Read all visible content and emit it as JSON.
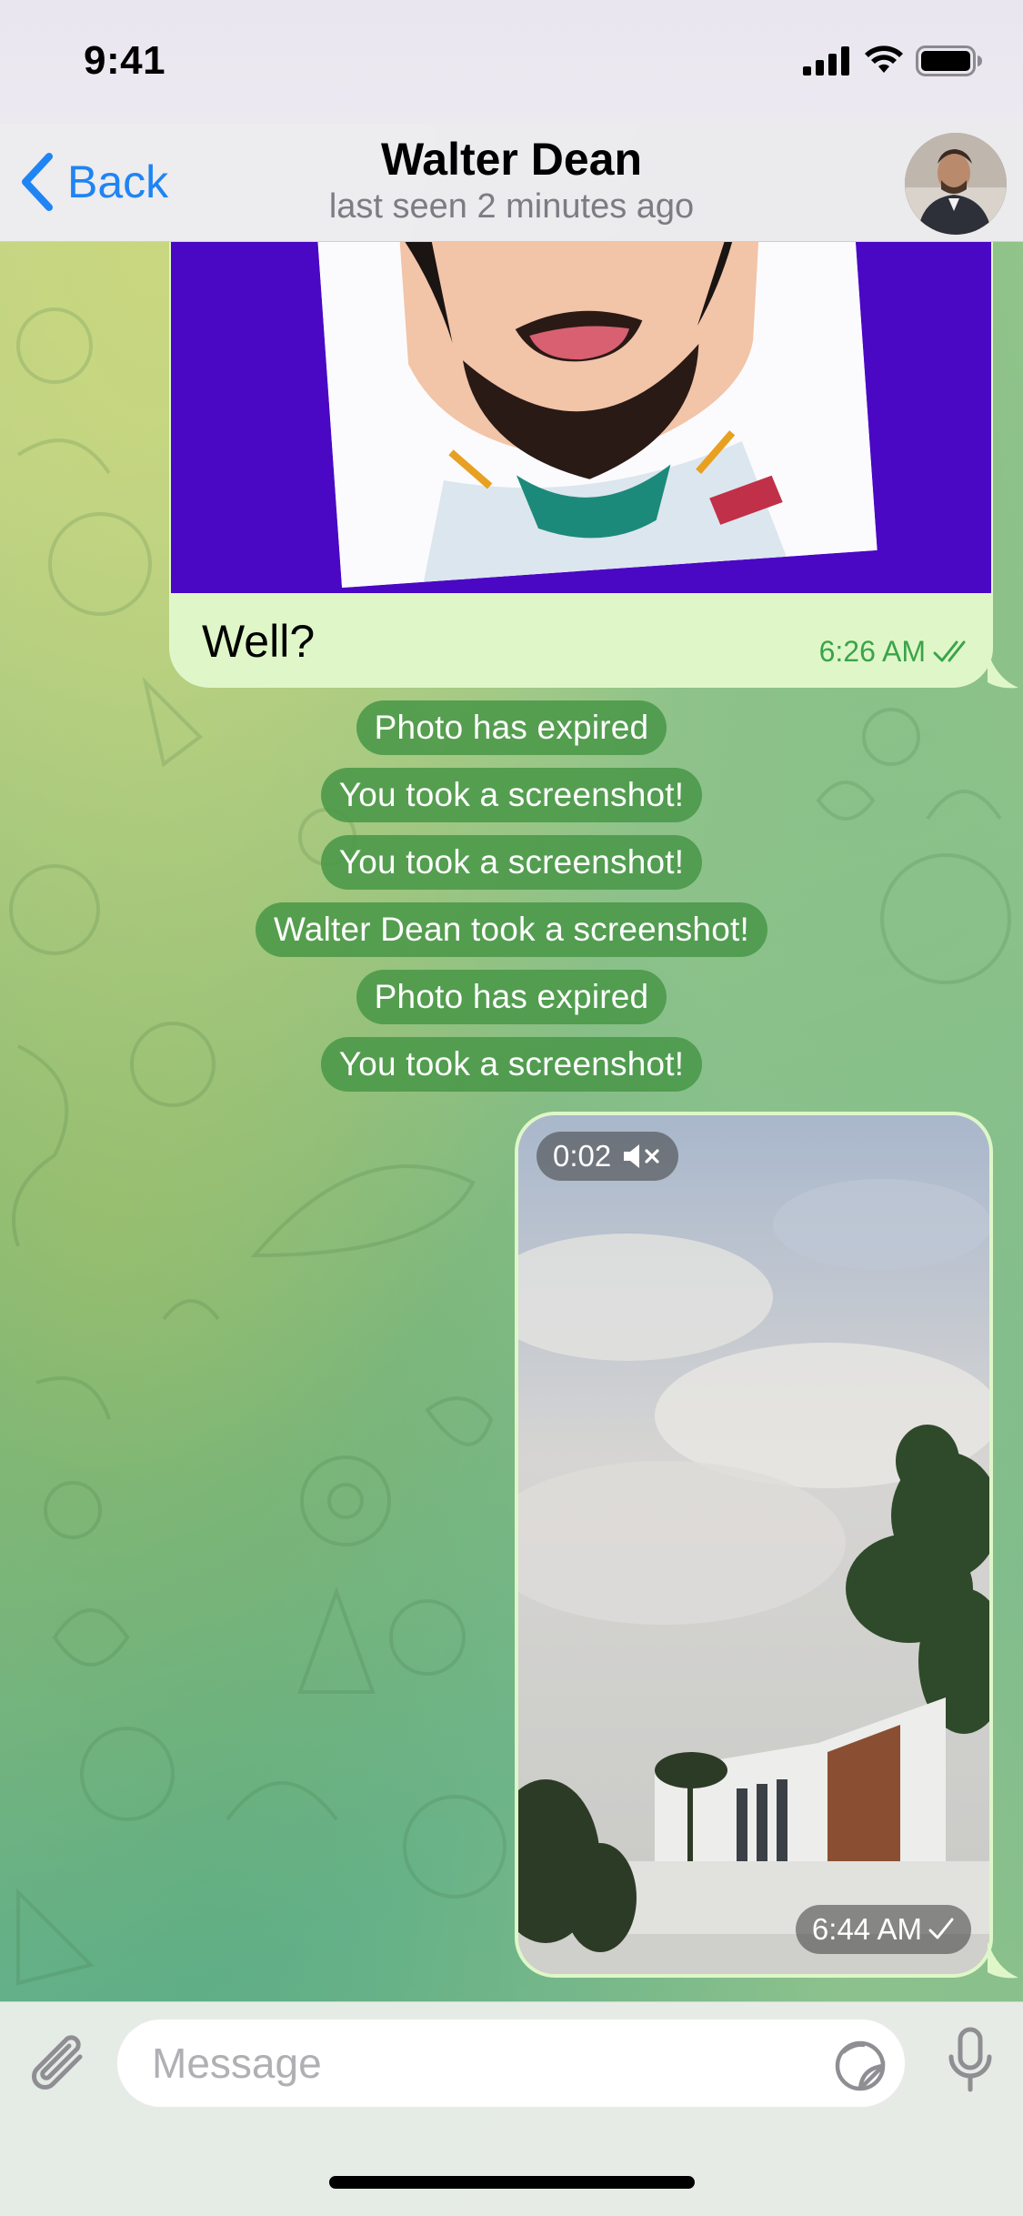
{
  "status_bar": {
    "time": "9:41"
  },
  "nav": {
    "back_label": "Back",
    "title": "Walter Dean",
    "subtitle": "last seen 2 minutes ago"
  },
  "messages": {
    "photo_message": {
      "caption": "Well?",
      "time": "6:26 AM"
    },
    "service": [
      "Photo has expired",
      "You took a screenshot!",
      "You took a screenshot!",
      "Walter Dean took a screenshot!",
      "Photo has expired",
      "You took a screenshot!"
    ],
    "video_message": {
      "duration": "0:02",
      "time": "6:44 AM"
    }
  },
  "input": {
    "placeholder": "Message"
  },
  "colors": {
    "accent": "#1f84f4",
    "outgoing_bubble": "#dff7c8",
    "outgoing_meta": "#3aa44a",
    "service_bg": "#4a9646"
  },
  "icons": [
    "cellular-signal-icon",
    "wifi-icon",
    "battery-icon",
    "chevron-left-icon",
    "read-checkmarks-icon",
    "muted-speaker-icon",
    "sent-checkmark-icon",
    "paperclip-icon",
    "sticker-icon",
    "microphone-icon"
  ]
}
